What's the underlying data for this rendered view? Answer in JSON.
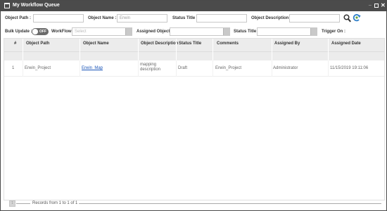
{
  "window": {
    "title": "My Workflow Queue",
    "minimize_glyph": "_",
    "close_glyph": "✕"
  },
  "filters": {
    "object_path": {
      "label": "Object Path :",
      "value": ""
    },
    "object_name": {
      "label": "Object Name :",
      "value": "Erwin"
    },
    "status_title": {
      "label": "Status Title :",
      "value": ""
    },
    "object_description": {
      "label": "Object Description :",
      "value": ""
    },
    "search_icon": "search-icon",
    "refresh_icon": "refresh-icon"
  },
  "options": {
    "bulk_update": {
      "label": "Bulk Update :",
      "toggle_text": "OFF"
    },
    "workflow": {
      "label": "WorkFlow :",
      "placeholder": "Select"
    },
    "assigned_object": {
      "label": "Assigned Object :",
      "value": ""
    },
    "status_title": {
      "label": "Status Title :",
      "value": ""
    },
    "trigger_on": {
      "label": "Trigger On :"
    }
  },
  "table": {
    "columns": [
      "#",
      "Object Path",
      "Object Name",
      "Object Description",
      "Status Title",
      "Comments",
      "Assigned By",
      "Assigned Date"
    ],
    "rows": [
      {
        "num": "1",
        "object_path": "Erwin_Project",
        "object_name": "Erwin_Map",
        "object_description": "mapping description",
        "status_title": "Draft",
        "comments": "Erwin_Project",
        "assigned_by": "Administrator",
        "assigned_date": "11/15/2019 19:11:06"
      }
    ]
  },
  "footer": {
    "page_label": "1",
    "records_text": "Records from 1 to 1 of 1"
  },
  "colors": {
    "titlebar": "#4b4b4b",
    "header_bg": "#ececec",
    "link": "#1a55b8",
    "toggle": "#6b6b6b"
  }
}
